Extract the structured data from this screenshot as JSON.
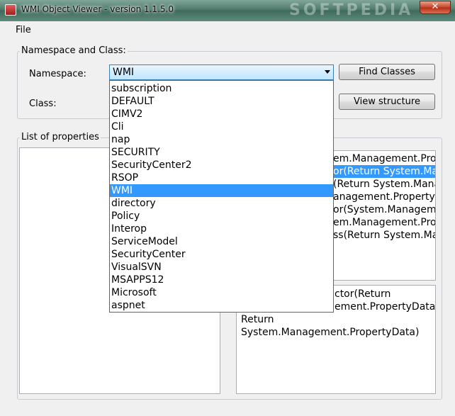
{
  "window": {
    "title": "WMI Object Viewer - version 1.1.5.0",
    "close_label": "✕",
    "watermark": "SOFTPEDIA"
  },
  "menu": {
    "file": "File"
  },
  "group": {
    "title": "Namespace and Class:",
    "namespace_label": "Namespace:",
    "class_label": "Class:",
    "namespace_value": "WMI",
    "find_classes": "Find Classes",
    "view_structure": "View structure"
  },
  "properties": {
    "title": "List of properties"
  },
  "methods": {
    "lines": [
      "Return System.Management.PropertyData",
      "Return System.Management.PropertyData",
      "Return System.Management.PropertyData",
      "Return System.Management.PropertyData",
      "Return System.Management.PropertyData",
      "Return System.Management.PropertyData",
      "Return System.Management.PropertyData"
    ],
    "visible": [
      "em.Management.Prope",
      "or(Return System.Man",
      "(Return System.Managemer",
      "anagement.PropertyData",
      "or(System.Managemen",
      "em.Management.Prope",
      "ss(Return System.Man"
    ],
    "selected_index": 1
  },
  "description": {
    "lines": [
      "ctor(Return",
      "ement.PropertyData,",
      "Return",
      "System.Management.PropertyData)"
    ]
  },
  "namespaces": {
    "selected": "WMI",
    "options": [
      "subscription",
      "DEFAULT",
      "CIMV2",
      "Cli",
      "nap",
      "SECURITY",
      "SecurityCenter2",
      "RSOP",
      "WMI",
      "directory",
      "Policy",
      "Interop",
      "ServiceModel",
      "SecurityCenter",
      "VisualSVN",
      "MSAPPS12",
      "Microsoft",
      "aspnet"
    ]
  }
}
